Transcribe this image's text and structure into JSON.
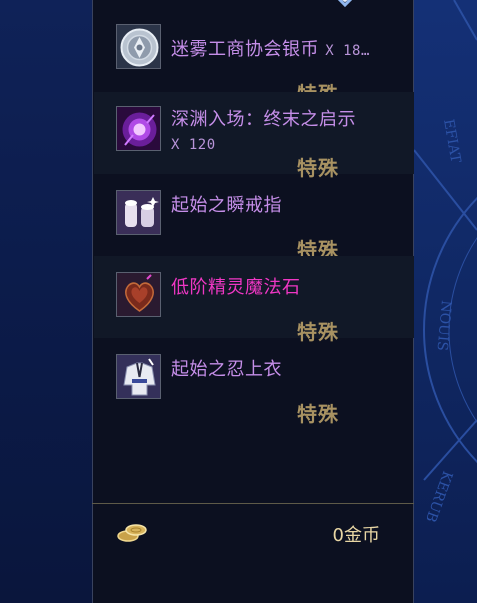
{
  "rewards": [
    {
      "name": "迷雾工商协会银币",
      "quantity": "X 18…",
      "rarity": "特殊",
      "name_color": "#c58ee8",
      "icon": "silver-coin-icon"
    },
    {
      "name": "深渊入场：终末之启示",
      "quantity": "X 120",
      "rarity": "特殊",
      "name_color": "#c58ee8",
      "icon": "purple-orb-icon"
    },
    {
      "name": "起始之瞬戒指",
      "quantity": "",
      "rarity": "特殊",
      "name_color": "#c58ee8",
      "icon": "ring-scroll-icon"
    },
    {
      "name": "低阶精灵魔法石",
      "quantity": "",
      "rarity": "特殊",
      "name_color": "#ef37c4",
      "icon": "heart-stone-icon"
    },
    {
      "name": "起始之忍上衣",
      "quantity": "",
      "rarity": "特殊",
      "name_color": "#c58ee8",
      "icon": "ninja-top-icon"
    }
  ],
  "footer": {
    "gold": "0金币",
    "icon": "gold-coins-icon"
  },
  "colors": {
    "rarity_special": "#a89262",
    "panel_bg": "#0c1020",
    "gold_text": "#e8d6a4"
  }
}
